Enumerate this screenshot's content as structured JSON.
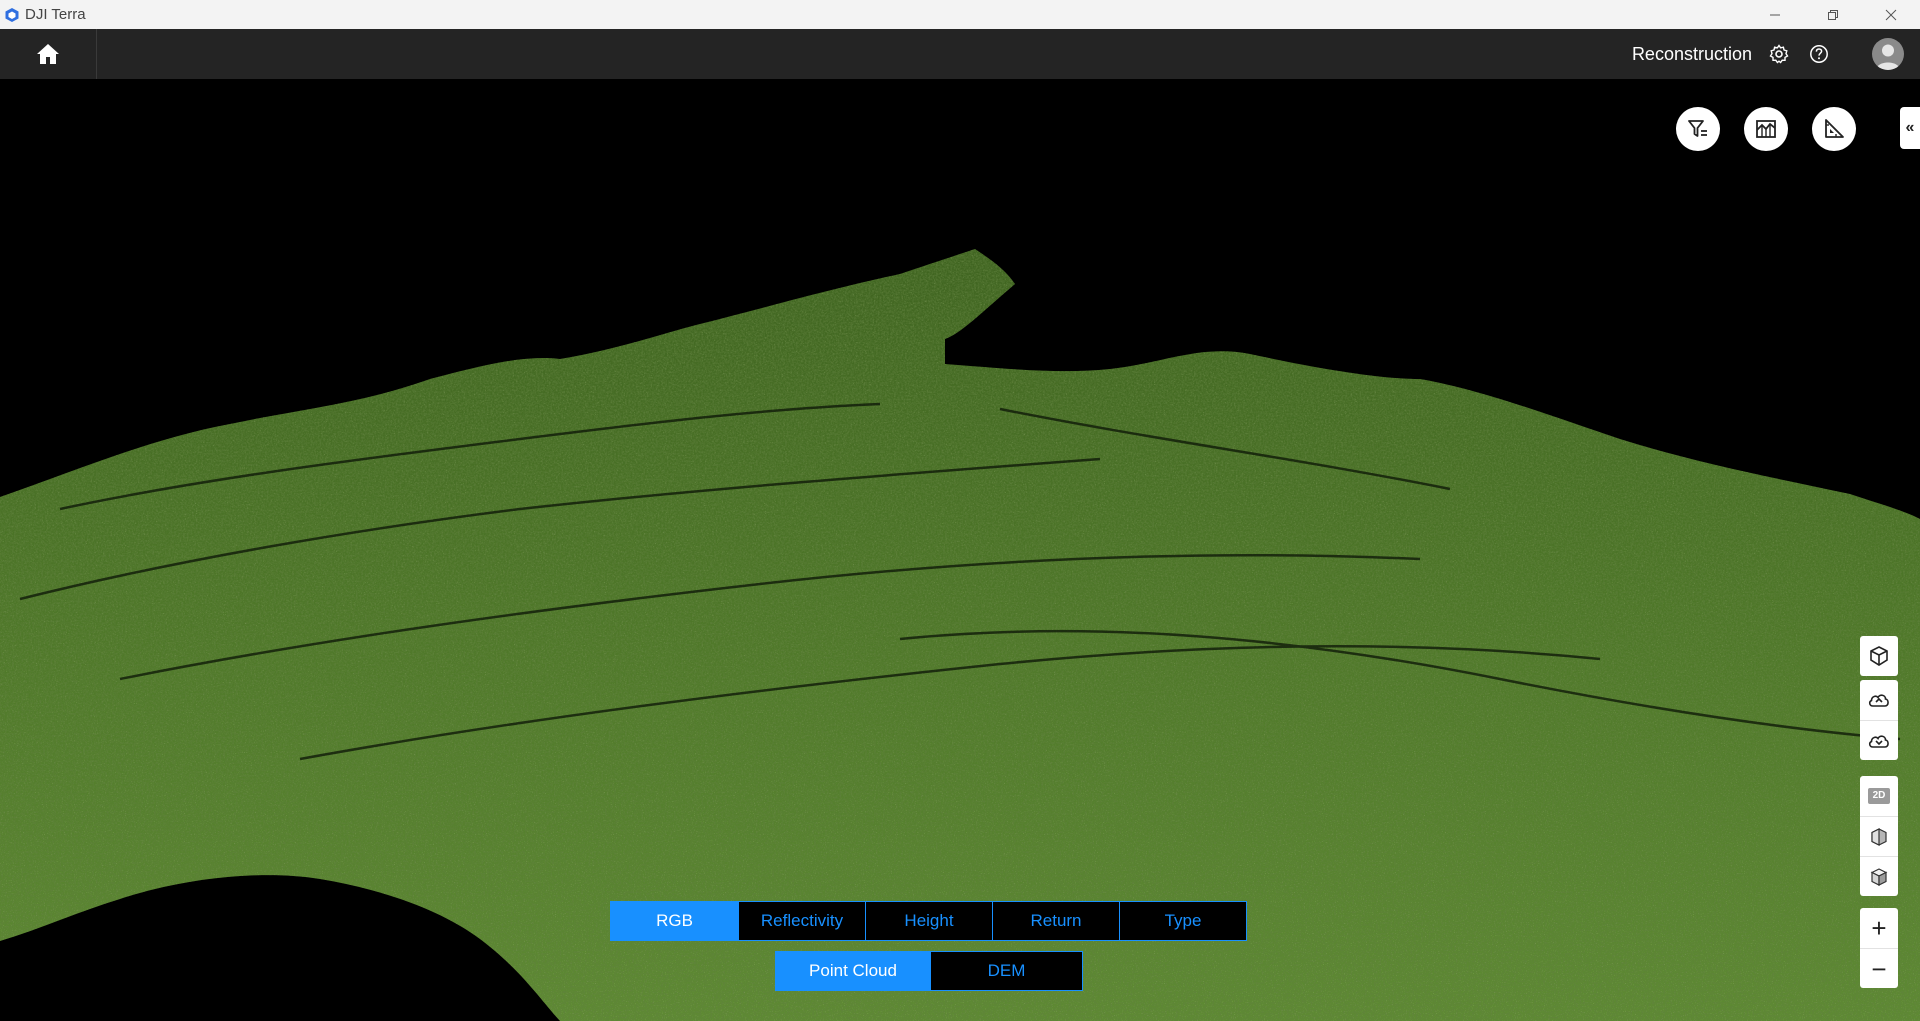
{
  "window": {
    "app_title": "DJI Terra",
    "controls": [
      "minimize-icon",
      "restore-icon",
      "close-icon"
    ]
  },
  "header": {
    "home_icon": "home-icon",
    "module_title": "Reconstruction",
    "icons": [
      "settings-icon",
      "help-icon",
      "user-avatar-icon"
    ]
  },
  "toolbar_top": {
    "tools": [
      "filter-icon",
      "chart-icon",
      "measure-icon"
    ],
    "collapse_label": "«"
  },
  "side_tools": {
    "group1": [
      "3d-model-icon"
    ],
    "group2": [
      "cloud-upload-icon",
      "cloud-download-icon"
    ],
    "group3": {
      "view_2d_label": "2D",
      "icons": [
        "cube-front-icon",
        "cube-iso-icon"
      ]
    },
    "zoom_in": "+",
    "zoom_out": "−"
  },
  "color_modes": {
    "items": [
      "RGB",
      "Reflectivity",
      "Height",
      "Return",
      "Type"
    ],
    "active": "RGB"
  },
  "data_modes": {
    "items": [
      "Point Cloud",
      "DEM"
    ],
    "active": "Point Cloud"
  },
  "colors": {
    "accent": "#1890ff",
    "header_bg": "#242424",
    "titlebar_bg": "#f3f3f3",
    "terrain_dark": "#2e4a17",
    "terrain_mid": "#4f7a2a",
    "terrain_light": "#7fa24a"
  }
}
